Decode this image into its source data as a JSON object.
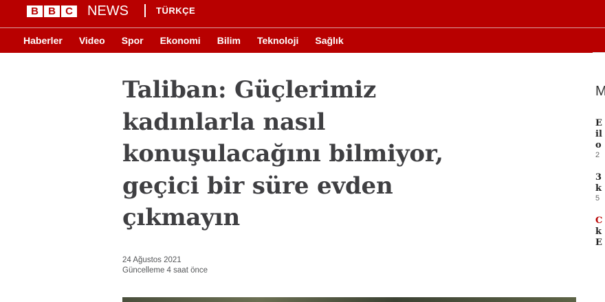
{
  "brand": {
    "logo_letters": [
      "B",
      "B",
      "C"
    ],
    "name": "NEWS",
    "subtitle": "TÜRKÇE"
  },
  "nav": {
    "items": [
      "Haberler",
      "Video",
      "Spor",
      "Ekonomi",
      "Bilim",
      "Teknoloji",
      "Sağlık"
    ]
  },
  "article": {
    "headline_lines": [
      "Taliban: Güçlerimiz",
      "kadınlarla nasıl",
      "konuşulacağını bilmiyor,",
      "geçici bir süre evden",
      "çıkmayın"
    ],
    "date": "24 Ağustos 2021",
    "updated": "Güncelleme 4 saat önce"
  },
  "sidebar_fragments": {
    "heading": "M",
    "lines": [
      "E",
      "il",
      "o",
      "2",
      "3",
      "k",
      "5",
      "C",
      "k",
      "E"
    ]
  },
  "colors": {
    "brand_red": "#b80000",
    "headline_text": "#3f3f42",
    "meta_text": "#545658"
  }
}
